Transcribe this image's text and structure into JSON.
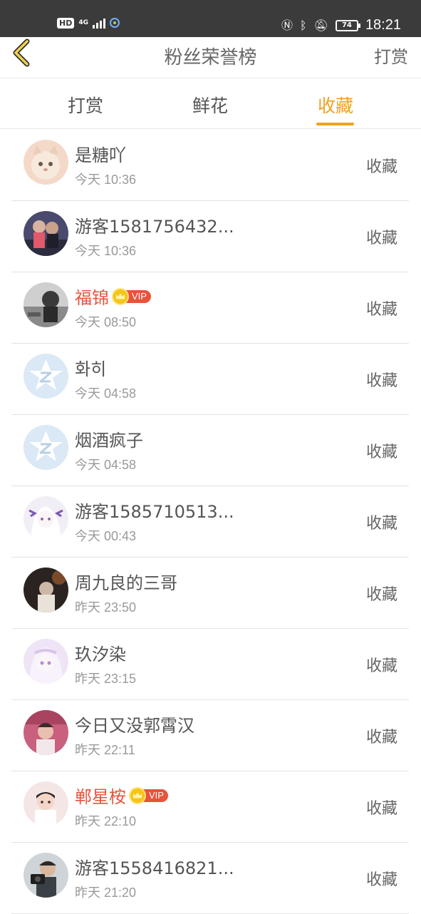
{
  "status_bar": {
    "hd": "HD",
    "network": "4G",
    "battery": "74",
    "time": "18:21"
  },
  "header": {
    "title": "粉丝荣誉榜",
    "action": "打赏"
  },
  "tabs": [
    {
      "label": "打赏",
      "active": false
    },
    {
      "label": "鲜花",
      "active": false
    },
    {
      "label": "收藏",
      "active": true
    }
  ],
  "accent_color": "#f0a21c",
  "vip_name_color": "#e8533b",
  "vip_label": "VIP",
  "rows": [
    {
      "name": "是糖吖",
      "time": "今天 10:36",
      "action": "收藏",
      "vip": false,
      "avatar": "cat"
    },
    {
      "name": "游客1581756432...",
      "time": "今天 10:36",
      "action": "收藏",
      "vip": false,
      "avatar": "couple"
    },
    {
      "name": "福锦",
      "time": "今天 08:50",
      "action": "收藏",
      "vip": true,
      "avatar": "bw"
    },
    {
      "name": "화히",
      "time": "今天 04:58",
      "action": "收藏",
      "vip": false,
      "avatar": "default"
    },
    {
      "name": "烟酒疯子",
      "time": "今天 04:58",
      "action": "收藏",
      "vip": false,
      "avatar": "default"
    },
    {
      "name": "游客1585710513...",
      "time": "今天 00:43",
      "action": "收藏",
      "vip": false,
      "avatar": "anime-white"
    },
    {
      "name": "周九良的三哥",
      "time": "昨天 23:50",
      "action": "收藏",
      "vip": false,
      "avatar": "dark"
    },
    {
      "name": "玖汐染",
      "time": "昨天 23:15",
      "action": "收藏",
      "vip": false,
      "avatar": "anime-purple"
    },
    {
      "name": "今日又没郭霄汉",
      "time": "昨天 22:11",
      "action": "收藏",
      "vip": false,
      "avatar": "pink"
    },
    {
      "name": "郸星桉",
      "time": "昨天 22:10",
      "action": "收藏",
      "vip": true,
      "avatar": "boy"
    },
    {
      "name": "游客1558416821...",
      "time": "昨天 21:20",
      "action": "收藏",
      "vip": false,
      "avatar": "camera"
    }
  ]
}
